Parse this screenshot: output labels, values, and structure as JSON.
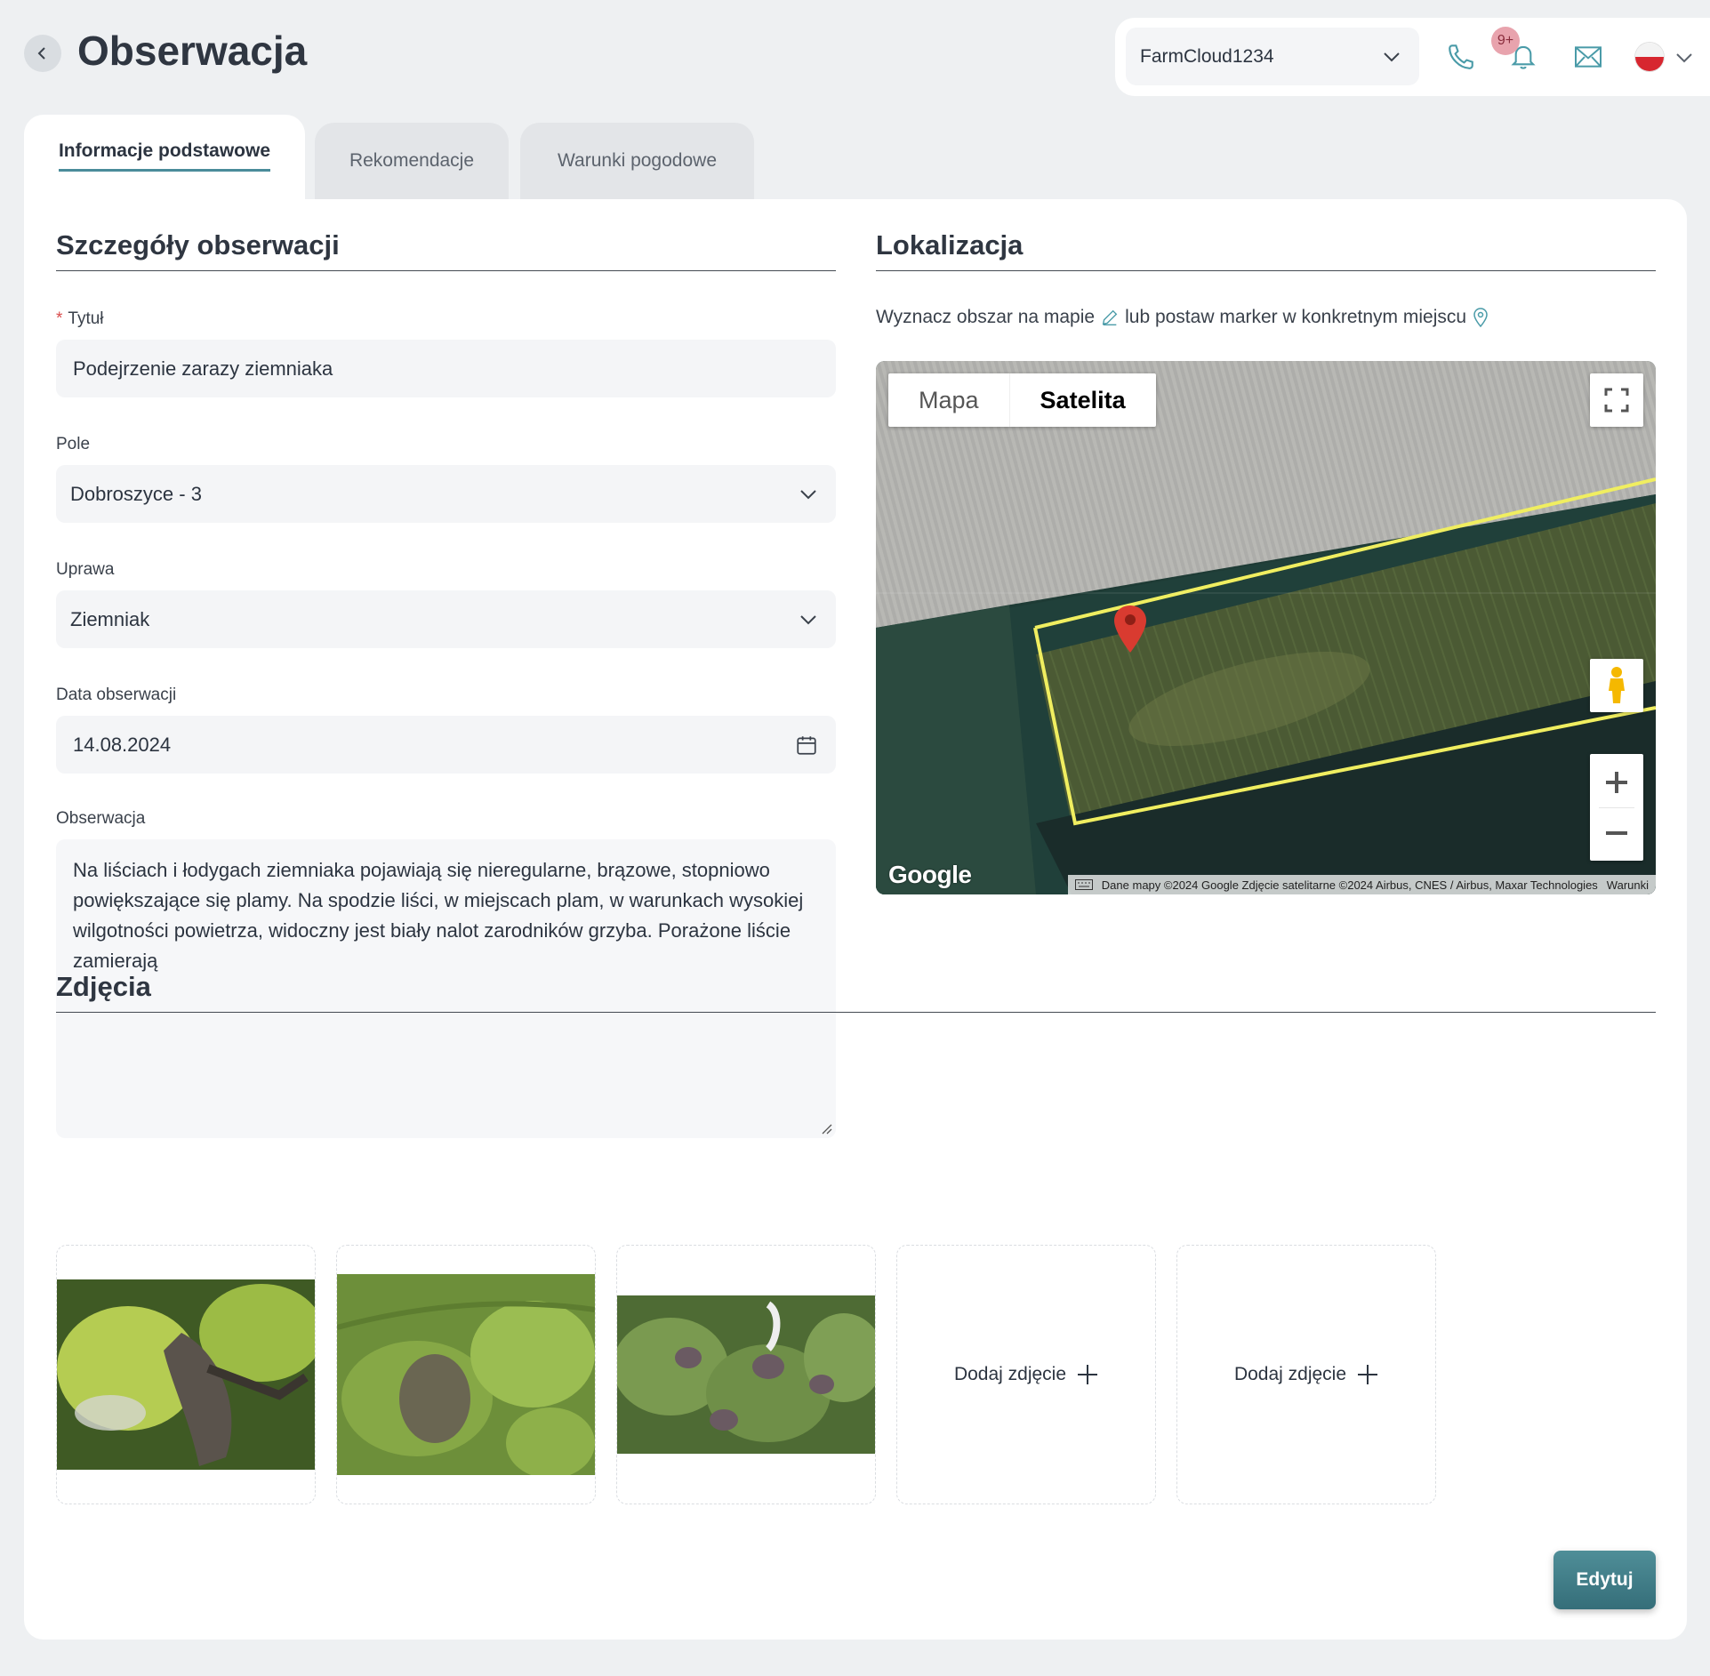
{
  "header": {
    "title": "Obserwacja",
    "farm_select": "FarmCloud1234",
    "notifications_badge": "9+"
  },
  "tabs": [
    {
      "label": "Informacje podstawowe",
      "active": true
    },
    {
      "label": "Rekomendacje",
      "active": false
    },
    {
      "label": "Warunki pogodowe",
      "active": false
    }
  ],
  "details": {
    "section_title": "Szczegóły obserwacji",
    "title_label": "Tytuł",
    "title_value": "Podejrzenie zarazy ziemniaka",
    "field_label": "Pole",
    "field_value": "Dobroszyce - 3",
    "crop_label": "Uprawa",
    "crop_value": "Ziemniak",
    "date_label": "Data obserwacji",
    "date_value": "14.08.2024",
    "observation_label": "Obserwacja",
    "observation_value": "Na liściach i łodygach ziemniaka pojawiają się nieregularne, brązowe, stopniowo powiększające się plamy. Na spodzie liści, w miejscach plam, w warunkach wysokiej wilgotności powietrza, widoczny jest biały nalot zarodników grzyba. Porażone liście zamierają"
  },
  "location": {
    "section_title": "Lokalizacja",
    "hint_part1": "Wyznacz obszar na mapie",
    "hint_part2": "lub postaw marker w konkretnym miejscu",
    "map_type_map": "Mapa",
    "map_type_satellite": "Satelita",
    "map_type_selected": "Satelita",
    "google_logo": "Google",
    "attribution": "Dane mapy ©2024 Google Zdjęcie satelitarne ©2024 Airbus, CNES / Airbus, Maxar Technologies",
    "terms": "Warunki"
  },
  "photos": {
    "section_title": "Zdjęcia",
    "add_label": "Dodaj zdjęcie"
  },
  "actions": {
    "edit": "Edytuj"
  },
  "colors": {
    "accent": "#4a8c9a",
    "required": "#d94c4c",
    "field_outline": "#f0ee60",
    "marker": "#d93b30"
  }
}
